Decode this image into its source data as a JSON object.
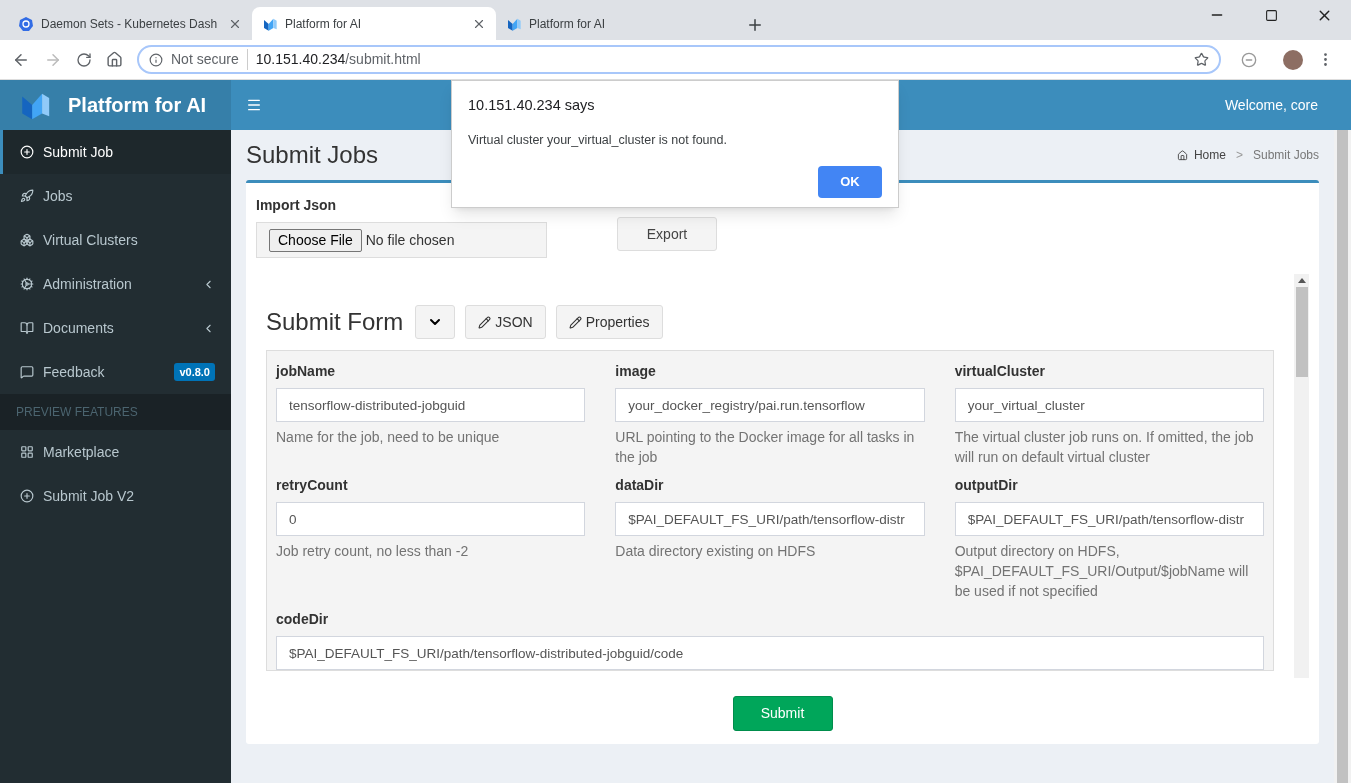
{
  "browser": {
    "tabs": [
      {
        "title": "Daemon Sets - Kubernetes Dash",
        "selected": false,
        "kind": "k8s",
        "closable": true
      },
      {
        "title": "Platform for AI",
        "selected": true,
        "kind": "pai",
        "closable": true
      },
      {
        "title": "Platform for AI",
        "selected": false,
        "kind": "pai",
        "closable": false
      }
    ],
    "security": "Not secure",
    "url_host": "10.151.40.234",
    "url_path": "/submit.html"
  },
  "app": {
    "brand": "Platform for AI",
    "welcome": "Welcome, core"
  },
  "sidebar": {
    "items": [
      {
        "label": "Submit Job",
        "selected": true,
        "has_submenu": false
      },
      {
        "label": "Jobs",
        "selected": false,
        "has_submenu": false
      },
      {
        "label": "Virtual Clusters",
        "selected": false,
        "has_submenu": false
      },
      {
        "label": "Administration",
        "selected": false,
        "has_submenu": true
      },
      {
        "label": "Documents",
        "selected": false,
        "has_submenu": true
      },
      {
        "label": "Feedback",
        "selected": false,
        "has_submenu": false,
        "badge": "v0.8.0"
      }
    ],
    "section": "PREVIEW FEATURES",
    "preview_items": [
      {
        "label": "Marketplace",
        "selected": false,
        "has_submenu": false
      },
      {
        "label": "Submit Job V2",
        "selected": false,
        "has_submenu": false
      }
    ]
  },
  "page": {
    "title": "Submit Jobs",
    "breadcrumb": [
      "Home",
      "Submit Jobs"
    ],
    "breadcrumb_separator": ">",
    "import_label": "Import Json",
    "choose_file": "Choose File",
    "no_file": "No file chosen",
    "export_button": "Export",
    "form_title": "Submit Form",
    "form_buttons": [
      "JSON",
      "Properties"
    ],
    "fields": [
      {
        "label": "jobName",
        "value": "tensorflow-distributed-jobguid",
        "help": "Name for the job, need to be unique",
        "full_width": false
      },
      {
        "label": "image",
        "value": "your_docker_registry/pai.run.tensorflow",
        "help": "URL pointing to the Docker image for all tasks in the job",
        "full_width": false
      },
      {
        "label": "virtualCluster",
        "value": "your_virtual_cluster",
        "help": "The virtual cluster job runs on. If omitted, the job will run on default virtual cluster",
        "full_width": false
      },
      {
        "label": "retryCount",
        "value": "0",
        "help": "Job retry count, no less than -2",
        "full_width": false
      },
      {
        "label": "dataDir",
        "value": "$PAI_DEFAULT_FS_URI/path/tensorflow-distr",
        "help": "Data directory existing on HDFS",
        "full_width": false
      },
      {
        "label": "outputDir",
        "value": "$PAI_DEFAULT_FS_URI/path/tensorflow-distr",
        "help": "Output directory on HDFS, $PAI_DEFAULT_FS_URI/Output/$jobName will be used if not specified",
        "full_width": false
      },
      {
        "label": "codeDir",
        "value": "$PAI_DEFAULT_FS_URI/path/tensorflow-distributed-jobguid/code",
        "full_width": true
      }
    ],
    "submit": "Submit"
  },
  "dialog": {
    "title": "10.151.40.234 says",
    "message": "Virtual cluster your_virtual_cluster is not found.",
    "button": "OK"
  }
}
